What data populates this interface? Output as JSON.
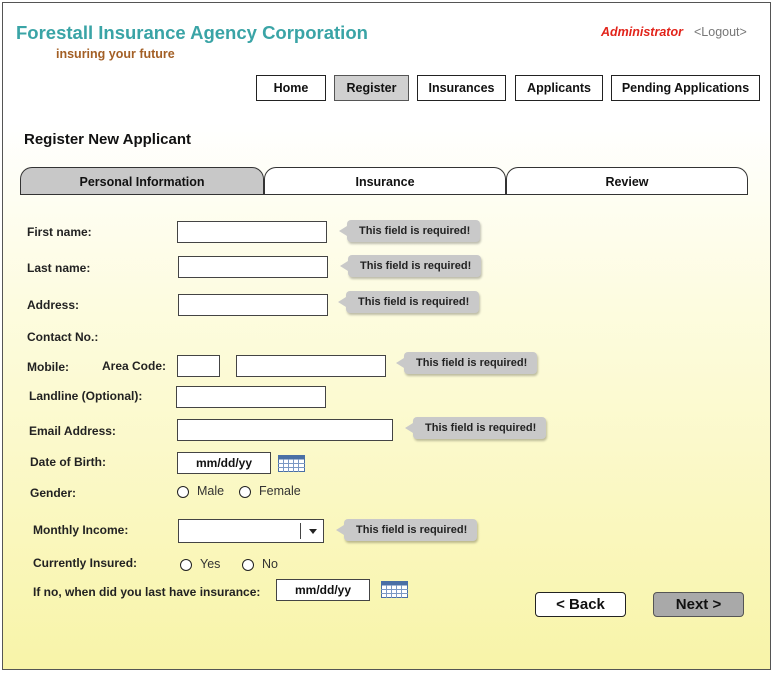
{
  "header": {
    "brand": "Forestall Insurance Agency Corporation",
    "tagline": "insuring your future",
    "user_role": "Administrator",
    "logout": "<Logout>"
  },
  "nav": {
    "home": "Home",
    "register": "Register",
    "insurances": "Insurances",
    "applicants": "Applicants",
    "pending": "Pending Applications",
    "active": "Register"
  },
  "page_title": "Register New Applicant",
  "tabs": {
    "personal": "Personal Information",
    "insurance": "Insurance",
    "review": "Review",
    "active": "Personal Information"
  },
  "form": {
    "first_name_label": "First name:",
    "last_name_label": "Last name:",
    "address_label": "Address:",
    "contact_label": "Contact No.:",
    "mobile_label": "Mobile:",
    "area_code_label": "Area Code:",
    "landline_label": "Landline (Optional):",
    "email_label": "Email Address:",
    "dob_label": "Date of Birth:",
    "dob_value": "mm/dd/yy",
    "gender_label": "Gender:",
    "gender_male": "Male",
    "gender_female": "Female",
    "income_label": "Monthly Income:",
    "insured_label": "Currently Insured:",
    "insured_yes": "Yes",
    "insured_no": "No",
    "last_insurance_label": "If no, when did you last have insurance:",
    "last_insurance_value": "mm/dd/yy",
    "required_message": "This field is required!"
  },
  "actions": {
    "back": "< Back",
    "next": "Next >"
  },
  "icons": {
    "calendar": "calendar-icon",
    "dropdown": "chevron-down-icon"
  },
  "colors": {
    "brand": "#3aa4a6",
    "tagline": "#a35f25",
    "admin": "#e2231a",
    "tooltip": "#c9c9c9",
    "active_tab": "#c8c8c8",
    "background_bottom": "#f8f4a8"
  }
}
